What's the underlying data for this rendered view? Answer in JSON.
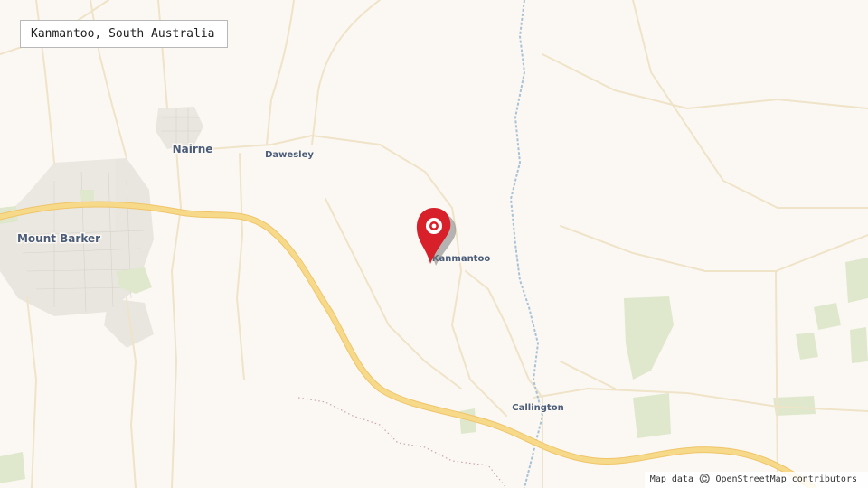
{
  "title": "Kanmantoo, South Australia",
  "places": [
    {
      "name": "Nairne",
      "kind": "town"
    },
    {
      "name": "Dawesley",
      "kind": "village"
    },
    {
      "name": "Mount Barker",
      "kind": "town"
    },
    {
      "name": "Kanmantoo",
      "kind": "village"
    },
    {
      "name": "Callington",
      "kind": "village"
    }
  ],
  "marker": {
    "label": "Kanmantoo",
    "color": "#d8202a",
    "icon": "map-pin-icon"
  },
  "attribution": "Map data ©️ OpenStreetMap contributors",
  "colors": {
    "land": "#fbf8f3",
    "highway": "#f7d98a",
    "highway_casing": "#efc56a",
    "minor_road": "#efe3c8",
    "urban": "#e6e3de",
    "park": "#dfe8cc",
    "river": "#a9c2d6",
    "boundary": "#c7a7b0"
  }
}
